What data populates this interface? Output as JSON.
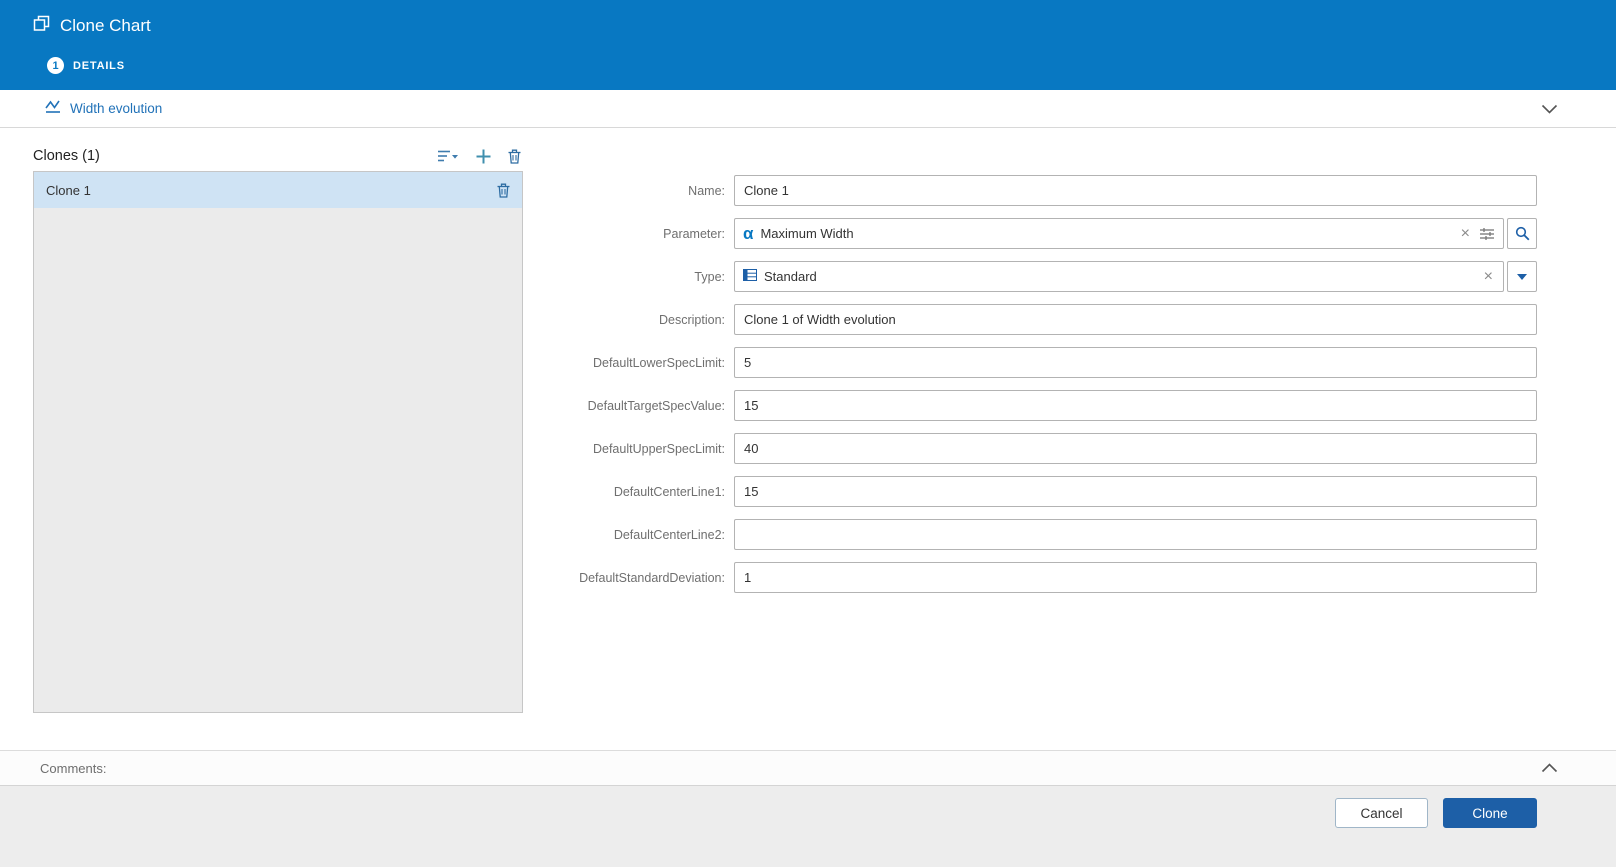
{
  "header": {
    "title": "Clone Chart",
    "step_number": "1",
    "step_label": "DETAILS"
  },
  "subheader": {
    "chart_name": "Width evolution"
  },
  "clones_panel": {
    "title": "Clones (1)",
    "items": [
      {
        "name": "Clone 1",
        "selected": true
      }
    ]
  },
  "form": {
    "name": {
      "label": "Name:",
      "value": "Clone 1"
    },
    "parameter": {
      "label": "Parameter:",
      "value": "Maximum Width"
    },
    "type": {
      "label": "Type:",
      "value": "Standard"
    },
    "description": {
      "label": "Description:",
      "value": "Clone 1 of Width evolution"
    },
    "lower_spec": {
      "label": "DefaultLowerSpecLimit:",
      "value": "5"
    },
    "target_spec": {
      "label": "DefaultTargetSpecValue:",
      "value": "15"
    },
    "upper_spec": {
      "label": "DefaultUpperSpecLimit:",
      "value": "40"
    },
    "center_line1": {
      "label": "DefaultCenterLine1:",
      "value": "15"
    },
    "center_line2": {
      "label": "DefaultCenterLine2:",
      "value": ""
    },
    "std_dev": {
      "label": "DefaultStandardDeviation:",
      "value": "1"
    }
  },
  "comments": {
    "label": "Comments:"
  },
  "footer": {
    "cancel_label": "Cancel",
    "clone_label": "Clone"
  },
  "icons": {
    "header": "clone-icon",
    "chart": "line-chart-icon",
    "sort": "sort-icon",
    "add": "plus-icon",
    "delete": "trash-icon",
    "parameter": "alpha-icon",
    "filter": "filter-icon",
    "search": "magnifier-icon",
    "type": "table-icon",
    "dropdown": "caret-down-icon",
    "collapse": "chevron-icon"
  },
  "colors": {
    "header_blue": "#0878c2",
    "primary_button": "#1d5fa7",
    "selected_row": "#cfe3f4",
    "link_blue": "#2172b8"
  }
}
